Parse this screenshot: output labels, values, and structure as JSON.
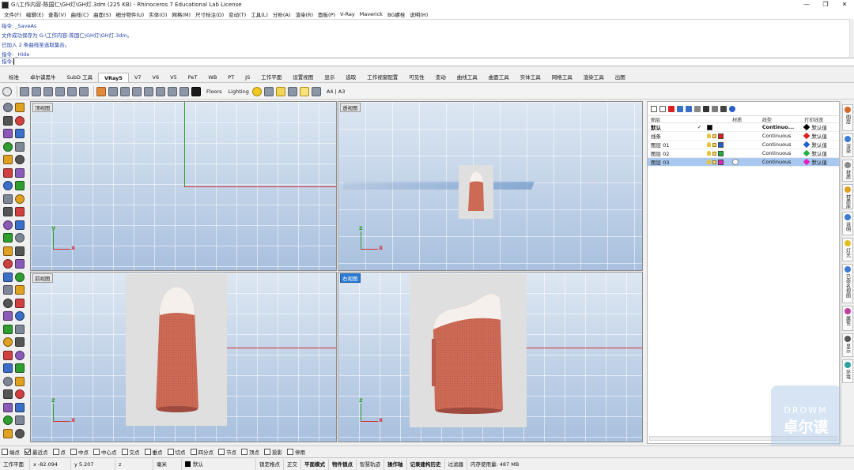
{
  "window": {
    "title": "G:\\工作内容-陈国仁\\GH灯\\GH灯.3dm (225 KB) - Rhinoceros 7 Educational Lab License",
    "buttons": [
      "—",
      "❐",
      "✕"
    ]
  },
  "menubar": [
    "文件(F)",
    "编辑(E)",
    "查看(V)",
    "曲线(C)",
    "曲面(S)",
    "细分物件(U)",
    "实体(O)",
    "网格(M)",
    "尺寸标注(D)",
    "变动(T)",
    "工具(L)",
    "分析(A)",
    "渲染(R)",
    "面板(P)",
    "V-Ray",
    "Maverick",
    "BG螺栓",
    "说明(H)"
  ],
  "command_history": [
    "指令: _SaveAs",
    "文件成功保存为 G:\\工作内容-陈国仁\\GH灯\\GH灯.3dm。",
    "已加入 2 条曲线至选取集合。",
    "指令: _Hide"
  ],
  "command_prompt": "指令:",
  "tabs": [
    "标准",
    "卓尔谟黑牛",
    "SubD 工具",
    "VRay5",
    "V7",
    "V6",
    "V5",
    "PeT",
    "WB",
    "PT",
    "JS",
    "工作平面",
    "设置视图",
    "显示",
    "选取",
    "工作视窗配置",
    "可见性",
    "变动",
    "曲线工具",
    "曲面工具",
    "实体工具",
    "网格工具",
    "渲染工具",
    "出图"
  ],
  "active_tab_index": 3,
  "toolbar": {
    "floors_label": "Floors",
    "lighting_label": "Lighting",
    "paper_label": "A4 | A3"
  },
  "viewports": {
    "top": {
      "label": "顶视图",
      "x_axis": "x",
      "y_axis": "y"
    },
    "perspective": {
      "label": "透视图",
      "x_axis": "x",
      "z_axis": "z"
    },
    "front": {
      "label": "前视图",
      "x_axis": "x",
      "z_axis": "z"
    },
    "right": {
      "label": "右视图",
      "x_axis": "x",
      "z_axis": "z"
    }
  },
  "layers": {
    "headers": {
      "name": "图层",
      "material": "材质",
      "linetype": "线型",
      "print_width": "打印线宽"
    },
    "rows": [
      {
        "name": "默认",
        "current": "✓",
        "color": "#000000",
        "linetype": "Continuo...",
        "print_width": "默认值",
        "pw_color": "#000000",
        "bold": true,
        "selected": false
      },
      {
        "name": "线条",
        "current": "",
        "color": "#e02020",
        "linetype": "Continuous",
        "print_width": "默认值",
        "pw_color": "#e02020",
        "bold": false,
        "selected": false
      },
      {
        "name": "图层 01",
        "current": "",
        "color": "#1f5fd0",
        "linetype": "Continuous",
        "print_width": "默认值",
        "pw_color": "#1f5fd0",
        "bold": false,
        "selected": false
      },
      {
        "name": "图层 02",
        "current": "",
        "color": "#1fb040",
        "linetype": "Continuous",
        "print_width": "默认值",
        "pw_color": "#1fb040",
        "bold": false,
        "selected": false
      },
      {
        "name": "图层 03",
        "current": "",
        "color": "#e020c0",
        "linetype": "Continuous",
        "print_width": "默认值",
        "pw_color": "#e020c0",
        "bold": false,
        "selected": true
      }
    ]
  },
  "right_tabs": [
    {
      "label": "图层",
      "color": "#d46a2a"
    },
    {
      "label": "渲染",
      "color": "#3a7bd5"
    },
    {
      "label": "材质",
      "color": "#8a8a8a"
    },
    {
      "label": "材质库",
      "color": "#e0a020"
    },
    {
      "label": "说明",
      "color": "#3a7bd5"
    },
    {
      "label": "灯光",
      "color": "#e0c020"
    },
    {
      "label": "已命名视图",
      "color": "#3a7bd5"
    },
    {
      "label": "属性",
      "color": "#c0409a"
    },
    {
      "label": "显示",
      "color": "#555555"
    },
    {
      "label": "环境",
      "color": "#30a0a0"
    }
  ],
  "osnaps": [
    {
      "label": "端点",
      "checked": false
    },
    {
      "label": "最近点",
      "checked": true
    },
    {
      "label": "点",
      "checked": false
    },
    {
      "label": "中点",
      "checked": false
    },
    {
      "label": "中心点",
      "checked": false
    },
    {
      "label": "交点",
      "checked": false
    },
    {
      "label": "垂点",
      "checked": false
    },
    {
      "label": "切点",
      "checked": false
    },
    {
      "label": "四分点",
      "checked": false
    },
    {
      "label": "节点",
      "checked": false
    },
    {
      "label": "顶点",
      "checked": false
    },
    {
      "label": "投影",
      "checked": false
    },
    {
      "label": "停用",
      "checked": false
    }
  ],
  "status": {
    "cplane": "工作平面",
    "x": "x -82.094",
    "y": "y 5.207",
    "z": "z",
    "unit": "毫米",
    "layer": "默认",
    "grid_snap": "锁定格点",
    "ortho": "正交",
    "planar": "平面模式",
    "osnap": "物件锁点",
    "smarttrack": "智慧轨迹",
    "gumball": "操作轴",
    "history": "记录建构历史",
    "filter": "过滤器",
    "memory": "内存使用量: 487 MB"
  },
  "watermark": {
    "top": "DROWM",
    "main": "卓尔谟"
  },
  "colors": {
    "accent": "#2b7bd4",
    "bottle_body": "#cc6a55",
    "bottle_cap": "#f5f0ec",
    "axis_x": "#d43030",
    "axis_y": "#2f9e2f"
  }
}
